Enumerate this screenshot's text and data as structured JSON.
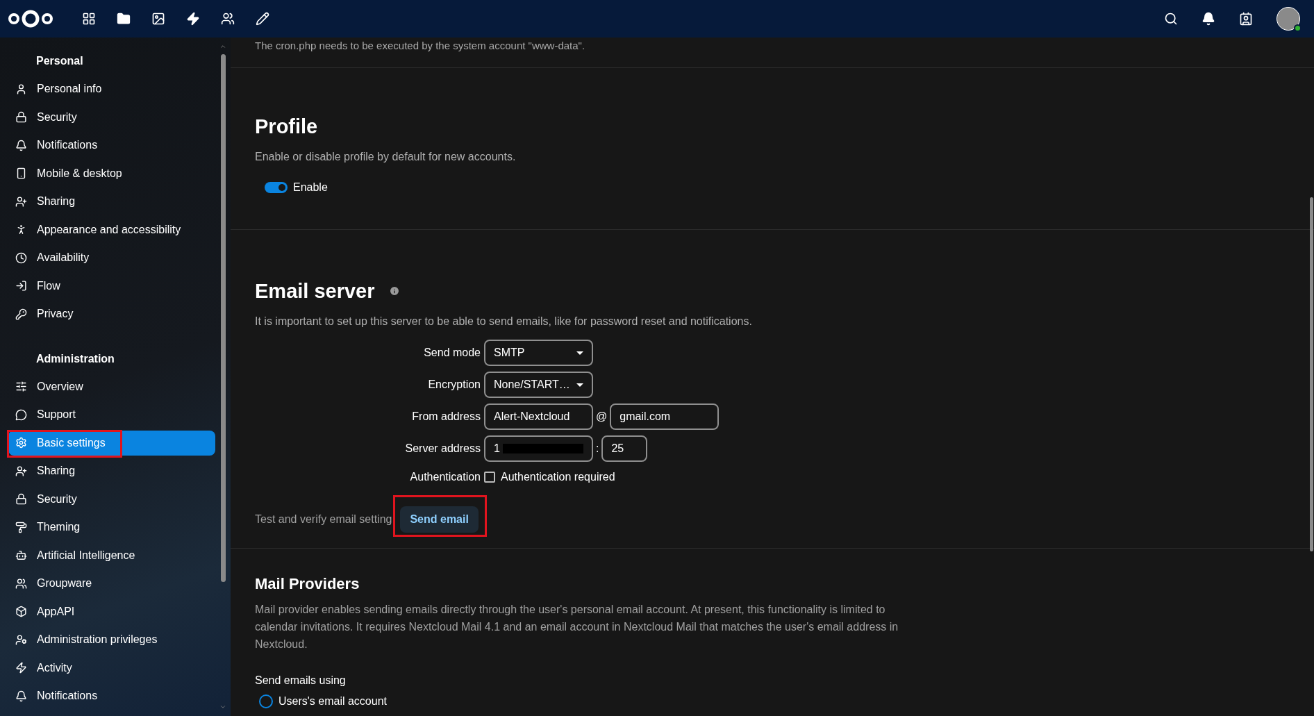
{
  "sidebar": {
    "sections": [
      {
        "title": "Personal",
        "items": [
          {
            "label": "Personal info",
            "selected": false,
            "highlighted": false
          },
          {
            "label": "Security",
            "selected": false,
            "highlighted": false
          },
          {
            "label": "Notifications",
            "selected": false,
            "highlighted": false
          },
          {
            "label": "Mobile & desktop",
            "selected": false,
            "highlighted": false
          },
          {
            "label": "Sharing",
            "selected": false,
            "highlighted": false
          },
          {
            "label": "Appearance and accessibility",
            "selected": false,
            "highlighted": false
          },
          {
            "label": "Availability",
            "selected": false,
            "highlighted": false
          },
          {
            "label": "Flow",
            "selected": false,
            "highlighted": false
          },
          {
            "label": "Privacy",
            "selected": false,
            "highlighted": false
          }
        ]
      },
      {
        "title": "Administration",
        "items": [
          {
            "label": "Overview",
            "selected": false,
            "highlighted": false
          },
          {
            "label": "Support",
            "selected": false,
            "highlighted": false
          },
          {
            "label": "Basic settings",
            "selected": true,
            "highlighted": true
          },
          {
            "label": "Sharing",
            "selected": false,
            "highlighted": false
          },
          {
            "label": "Security",
            "selected": false,
            "highlighted": false
          },
          {
            "label": "Theming",
            "selected": false,
            "highlighted": false
          },
          {
            "label": "Artificial Intelligence",
            "selected": false,
            "highlighted": false
          },
          {
            "label": "Groupware",
            "selected": false,
            "highlighted": false
          },
          {
            "label": "AppAPI",
            "selected": false,
            "highlighted": false
          },
          {
            "label": "Administration privileges",
            "selected": false,
            "highlighted": false
          },
          {
            "label": "Activity",
            "selected": false,
            "highlighted": false
          },
          {
            "label": "Notifications",
            "selected": false,
            "highlighted": false
          }
        ]
      }
    ]
  },
  "main": {
    "cron_note": "The cron.php needs to be executed by the system account \"www-data\".",
    "profile": {
      "title": "Profile",
      "description": "Enable or disable profile by default for new accounts.",
      "toggle": {
        "label": "Enable",
        "on": true
      }
    },
    "email_server": {
      "title": "Email server",
      "description": "It is important to set up this server to be able to send emails, like for password reset and notifications.",
      "fields": [
        {
          "kind": "select",
          "label": "Send mode",
          "value": "SMTP"
        },
        {
          "kind": "select",
          "label": "Encryption",
          "value": "None/START…"
        },
        {
          "kind": "pair",
          "label": "From address",
          "value": "Alert-Nextcloud",
          "separator": "@",
          "value_2": "gmail.com"
        },
        {
          "kind": "pair",
          "label": "Server address",
          "value": "1",
          "separator": ":",
          "value_2": "25",
          "redacted": true
        },
        {
          "kind": "checkbox",
          "label": "Authentication",
          "checkbox_label": "Authentication required",
          "checked": false
        }
      ],
      "test": {
        "label": "Test and verify email setting",
        "button": "Send email",
        "highlighted": true
      }
    },
    "mail_providers": {
      "title": "Mail Providers",
      "description": "Mail provider enables sending emails directly through the user's personal email account. At present, this functionality is limited to calendar invitations. It requires Nextcloud Mail 4.1 and an email account in Nextcloud Mail that matches the user's email address in Nextcloud.",
      "option_label": "Send emails using",
      "options": [
        {
          "label": "Users's email account",
          "selected": false
        }
      ]
    }
  }
}
